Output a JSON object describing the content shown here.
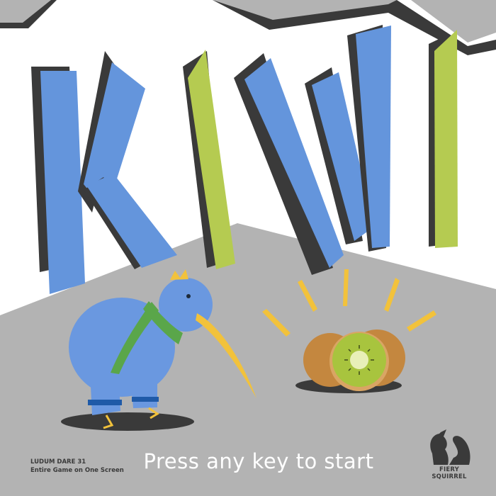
{
  "game": {
    "title_letters": [
      "K",
      "I",
      "W",
      "I"
    ],
    "start_prompt": "Press any key to start"
  },
  "event": {
    "name": "LUDUM DARE 31",
    "theme": "Entire Game on One Screen"
  },
  "studio": {
    "name": "FIERY SQUIRREL",
    "logo_icon": "squirrel-icon"
  },
  "colors": {
    "background": "#ffffff",
    "floor": "#b3b3b3",
    "wall_outline": "#3a3a3a",
    "letter_blue": "#6495dc",
    "letter_green": "#b5cb51",
    "kiwi_body": "#6a98e0",
    "kiwi_beak": "#f2c23b",
    "scarf": "#5aa64a",
    "fruit_skin": "#c4873f",
    "fruit_flesh": "#a8c43e"
  }
}
